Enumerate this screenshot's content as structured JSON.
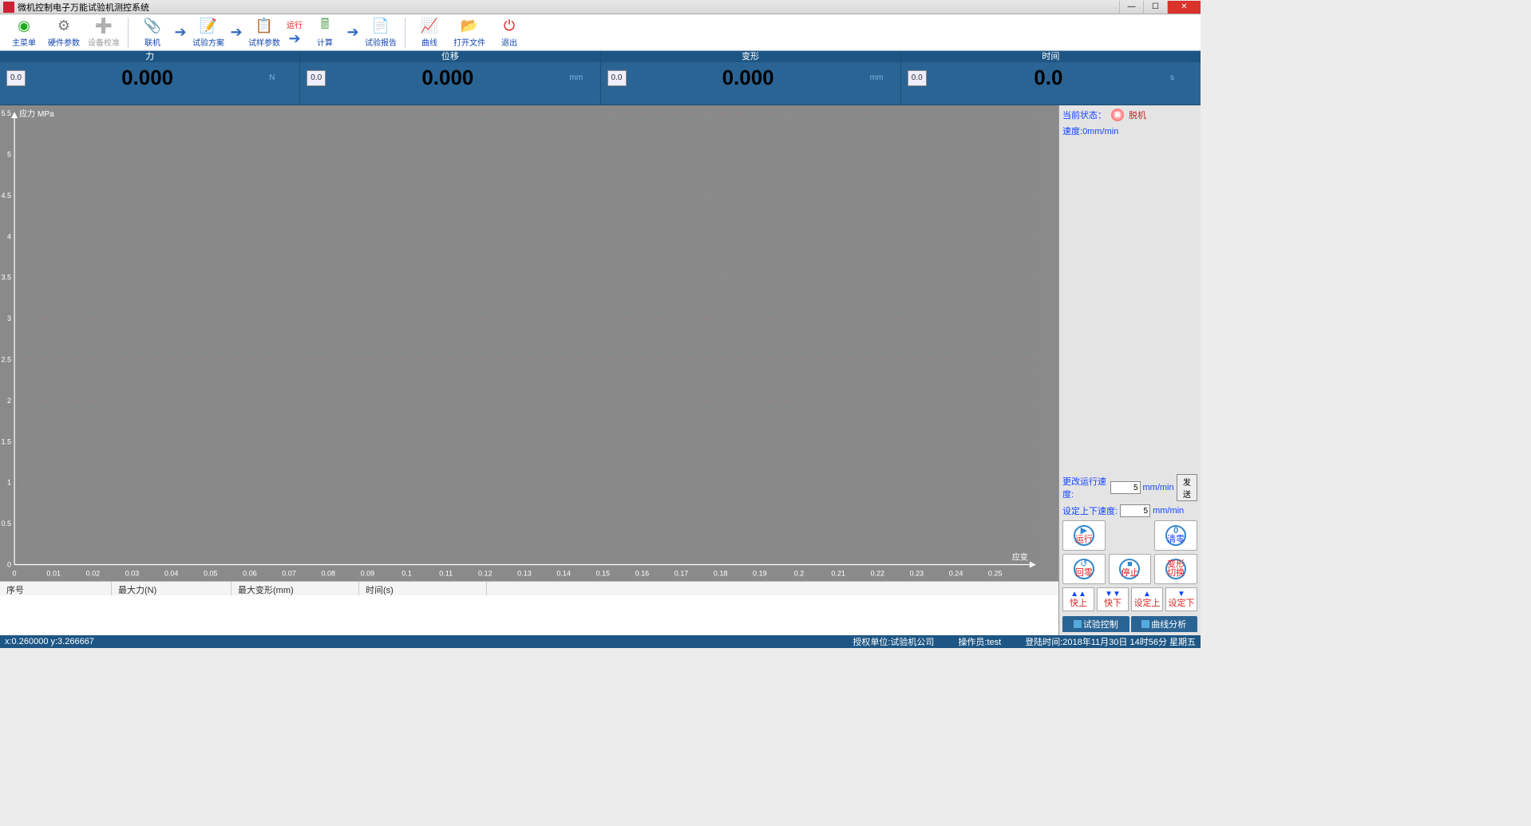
{
  "window": {
    "title": "微机控制电子万能试验机测控系统"
  },
  "toolbar": {
    "main_menu": "主菜单",
    "hardware_params": "硬件参数",
    "device_calibrate": "设备校准",
    "connect": "联机",
    "test_plan": "试验方案",
    "sample_params": "试样参数",
    "run_flag": "运行",
    "calculate": "计算",
    "test_report": "试验报告",
    "curve": "曲线",
    "open_file": "打开文件",
    "exit": "退出"
  },
  "readouts": {
    "force": {
      "name": "力",
      "box": "0.0",
      "value": "0.000",
      "unit": "N",
      "sub": ""
    },
    "disp": {
      "name": "位移",
      "box": "0.0",
      "value": "0.000",
      "unit": "mm",
      "sub": ""
    },
    "deform": {
      "name": "变形",
      "box": "0.0",
      "value": "0.000",
      "unit": "mm",
      "sub": ""
    },
    "time": {
      "name": "时间",
      "box": "0.0",
      "value": "0.0",
      "unit": "s",
      "sub": ""
    }
  },
  "chart_data": {
    "type": "line",
    "series": [],
    "xlabel": "应变",
    "ylabel": "应力 MPa",
    "xlim": [
      0,
      0.26
    ],
    "ylim": [
      0,
      5.5
    ],
    "xticks": [
      0,
      0.01,
      0.02,
      0.03,
      0.04,
      0.05,
      0.06,
      0.07,
      0.08,
      0.09,
      0.1,
      0.11,
      0.12,
      0.13,
      0.14,
      0.15,
      0.16,
      0.17,
      0.18,
      0.19,
      0.2,
      0.21,
      0.22,
      0.23,
      0.24,
      0.25
    ],
    "yticks": [
      0,
      0.5,
      1,
      1.5,
      2,
      2.5,
      3,
      3.5,
      4,
      4.5,
      5,
      5.5
    ]
  },
  "right_panel": {
    "status_label": "当前状态：",
    "status_value": "脱机",
    "speed_label": "速度:",
    "speed_value": "0mm/min",
    "change_speed_label": "更改运行速度:",
    "change_speed_value": "5",
    "change_speed_unit": "mm/min",
    "send": "发送",
    "set_ud_label": "设定上下速度:",
    "set_ud_value": "5",
    "set_ud_unit": "mm/min",
    "run": "运行",
    "zero": "清零",
    "return_zero": "回零",
    "stop": "停止",
    "deform_switch1": "变形",
    "deform_switch2": "切换",
    "fast_up": "快上",
    "fast_down": "快下",
    "set_up": "设定上",
    "set_down": "设定下",
    "tab_control": "试验控制",
    "tab_curve": "曲线分析"
  },
  "table": {
    "col_seq": "序号",
    "col_maxforce": "最大力(N)",
    "col_maxdeform": "最大变形(mm)",
    "col_time": "时间(s)"
  },
  "statusbar": {
    "coord": "x:0.260000 y:3.266667",
    "auth_unit": "授权单位:试验机公司",
    "operator": "操作员:test",
    "login_time": "登陆时间:2018年11月30日 14时56分 星期五"
  }
}
